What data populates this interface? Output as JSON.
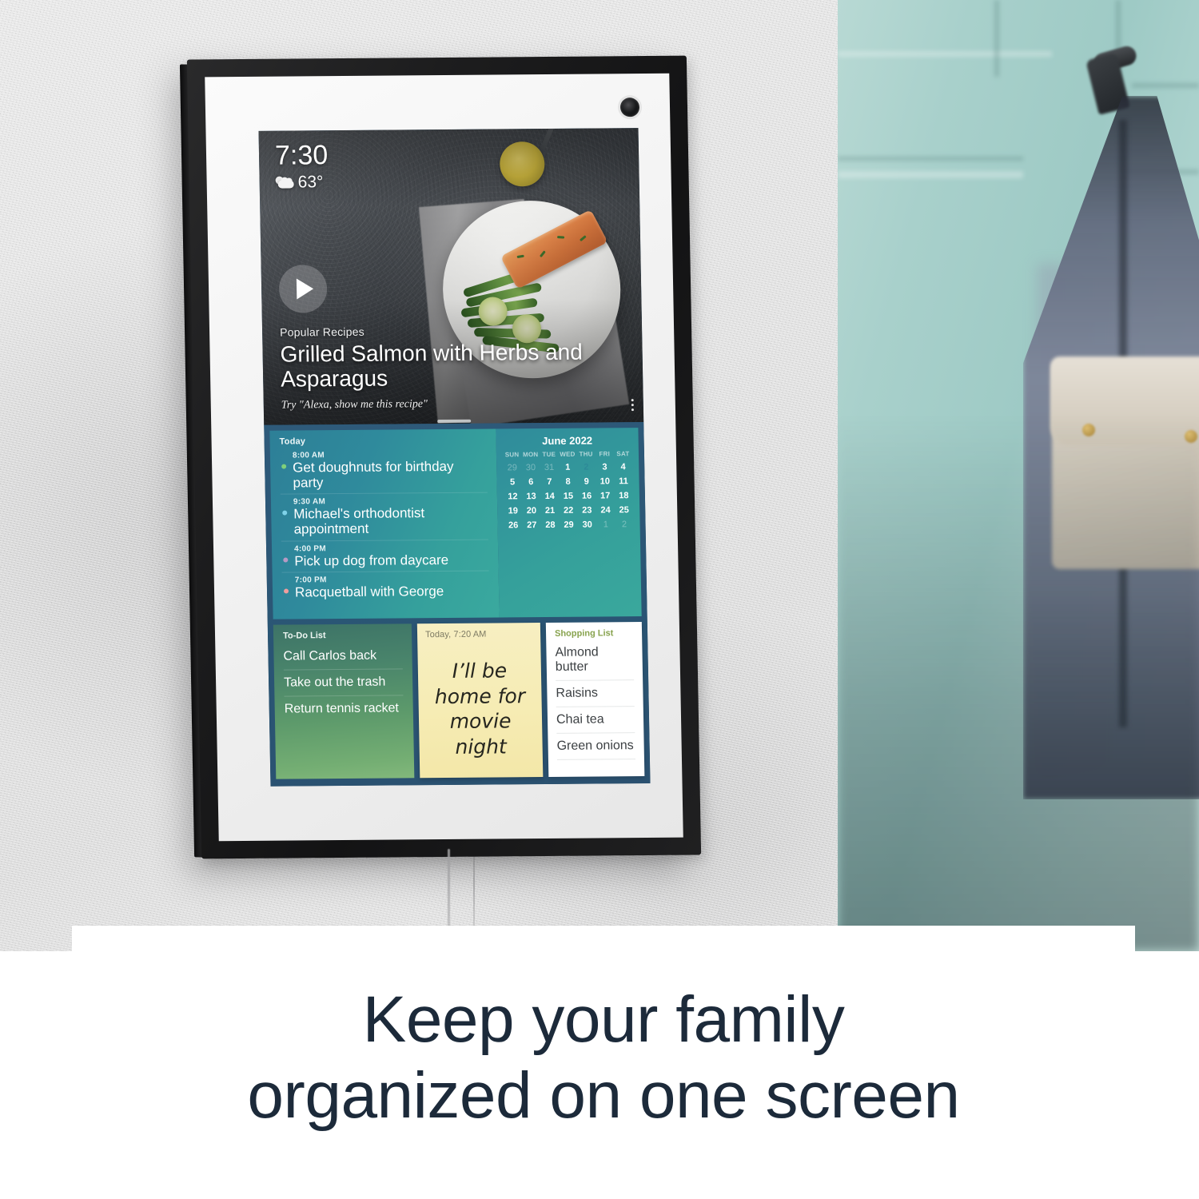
{
  "caption": {
    "line1": "Keep your family",
    "line2": "organized on one screen"
  },
  "device": {
    "status_bar": {
      "time": "7:30",
      "temperature": "63°",
      "weather_icon": "partly-cloudy-icon"
    },
    "hero_card": {
      "kicker": "Popular Recipes",
      "title": "Grilled Salmon with Herbs and Asparagus",
      "hint": "Try \"Alexa, show me this recipe\"",
      "play_icon": "play-icon",
      "overflow_icon": "more-options-icon"
    },
    "agenda": {
      "label": "Today",
      "events": [
        {
          "time": "8:00 AM",
          "title": "Get doughnuts for birthday party",
          "dot_color": "#7fd07a"
        },
        {
          "time": "9:30 AM",
          "title": "Michael's orthodontist appointment",
          "dot_color": "#7fd2e8"
        },
        {
          "time": "4:00 PM",
          "title": "Pick up dog from daycare",
          "dot_color": "#b79ac4"
        },
        {
          "time": "7:00 PM",
          "title": "Racquetball with George",
          "dot_color": "#ef9e9e"
        }
      ]
    },
    "calendar": {
      "title": "June 2022",
      "day_headers": [
        "SUN",
        "MON",
        "TUE",
        "WED",
        "THU",
        "FRI",
        "SAT"
      ],
      "today": 2,
      "weeks": [
        [
          {
            "d": "29",
            "m": true
          },
          {
            "d": "30",
            "m": true
          },
          {
            "d": "31",
            "m": true
          },
          {
            "d": "1",
            "m": false
          },
          {
            "d": "2",
            "m": false,
            "t": true
          },
          {
            "d": "3",
            "m": false
          },
          {
            "d": "4",
            "m": false
          }
        ],
        [
          {
            "d": "5",
            "m": false
          },
          {
            "d": "6",
            "m": false
          },
          {
            "d": "7",
            "m": false
          },
          {
            "d": "8",
            "m": false
          },
          {
            "d": "9",
            "m": false
          },
          {
            "d": "10",
            "m": false
          },
          {
            "d": "11",
            "m": false
          }
        ],
        [
          {
            "d": "12",
            "m": false
          },
          {
            "d": "13",
            "m": false
          },
          {
            "d": "14",
            "m": false
          },
          {
            "d": "15",
            "m": false
          },
          {
            "d": "16",
            "m": false
          },
          {
            "d": "17",
            "m": false
          },
          {
            "d": "18",
            "m": false
          }
        ],
        [
          {
            "d": "19",
            "m": false
          },
          {
            "d": "20",
            "m": false
          },
          {
            "d": "21",
            "m": false
          },
          {
            "d": "22",
            "m": false
          },
          {
            "d": "23",
            "m": false
          },
          {
            "d": "24",
            "m": false
          },
          {
            "d": "25",
            "m": false
          }
        ],
        [
          {
            "d": "26",
            "m": false
          },
          {
            "d": "27",
            "m": false
          },
          {
            "d": "28",
            "m": false
          },
          {
            "d": "29",
            "m": false
          },
          {
            "d": "30",
            "m": false
          },
          {
            "d": "1",
            "m": true
          },
          {
            "d": "2",
            "m": true
          }
        ]
      ]
    },
    "todo": {
      "label": "To-Do List",
      "items": [
        "Call Carlos back",
        "Take out the trash",
        "Return tennis racket"
      ]
    },
    "sticky_note": {
      "meta": "Today, 7:20 AM",
      "body": "I’ll be home for movie night"
    },
    "shopping": {
      "label": "Shopping List",
      "items": [
        "Almond butter",
        "Raisins",
        "Chai tea",
        "Green onions"
      ]
    }
  },
  "colors": {
    "board_bg": "#2d5676",
    "agenda_teal": "#2f8a9c",
    "todo_green": "#5d9a6b",
    "note_yellow": "#f6ecb4",
    "shopping_white": "#ffffff",
    "shopping_label": "#88a34e",
    "caption_text": "#1c2a3a",
    "frame_black": "#1a1a1b",
    "mat_white": "#f4f4f4"
  }
}
